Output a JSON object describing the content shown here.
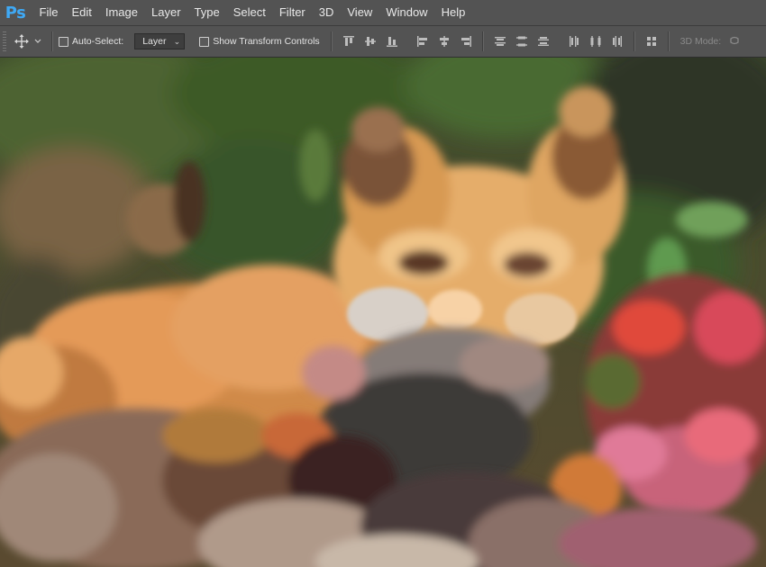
{
  "app": {
    "logo": "Ps"
  },
  "menu": [
    "File",
    "Edit",
    "Image",
    "Layer",
    "Type",
    "Select",
    "Filter",
    "3D",
    "View",
    "Window",
    "Help"
  ],
  "options": {
    "auto_select_label": "Auto-Select:",
    "auto_select_checked": false,
    "target_value": "Layer",
    "show_transform_label": "Show Transform Controls",
    "show_transform_checked": false,
    "mode_label": "3D Mode:"
  },
  "icons": {
    "move_tool": "move-tool-icon",
    "align": [
      "align-top-edges-icon",
      "align-vertical-centers-icon",
      "align-bottom-edges-icon",
      "align-left-edges-icon",
      "align-horizontal-centers-icon",
      "align-right-edges-icon"
    ],
    "distribute": [
      "distribute-top-edges-icon",
      "distribute-vertical-centers-icon",
      "distribute-bottom-edges-icon",
      "distribute-left-edges-icon",
      "distribute-horizontal-centers-icon",
      "distribute-right-edges-icon"
    ],
    "auto_align": "auto-align-layers-icon",
    "mode_3d": "3d-orbit-icon"
  },
  "colors": {
    "logo": "#3fa9f5",
    "chrome": "#535353"
  }
}
